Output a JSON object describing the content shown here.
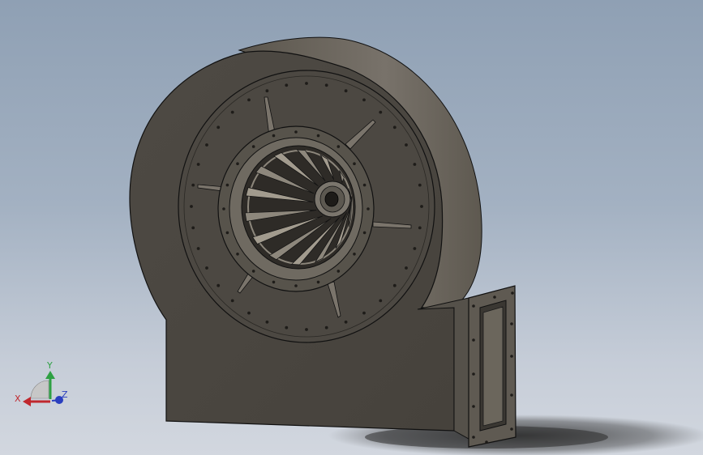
{
  "viewport": {
    "background_top": "#8fa0b4",
    "background_bottom": "#d2d7df"
  },
  "model": {
    "body_color": "#4a4640",
    "edge_color": "#111111",
    "rim_color": "#6e695f",
    "hole_color": "#1e1c19"
  },
  "triad": {
    "x_label": "X",
    "y_label": "Y",
    "z_label": "Z",
    "x_color": "#c0282e",
    "y_color": "#2ea043",
    "z_color": "#2a3fbf"
  }
}
